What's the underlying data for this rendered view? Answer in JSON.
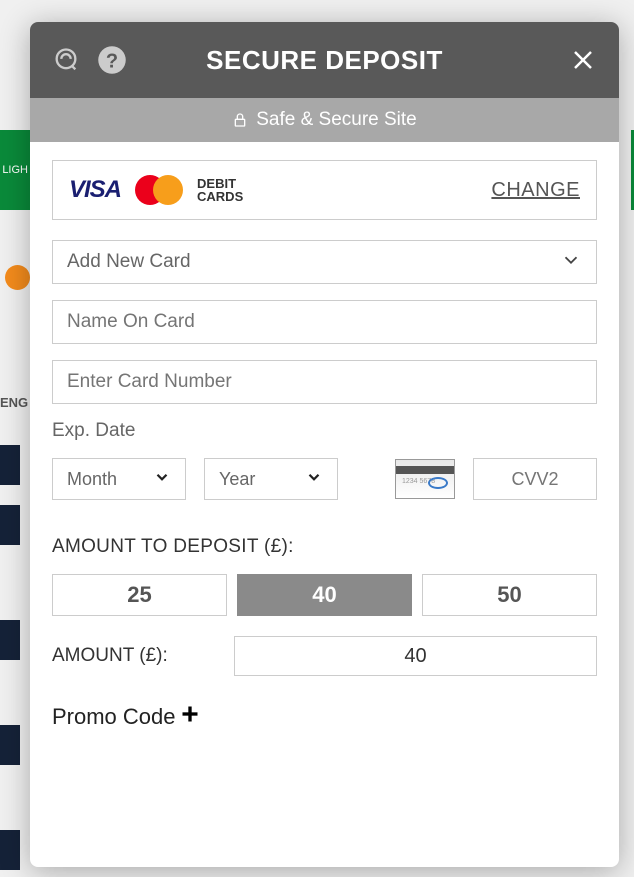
{
  "header": {
    "title": "SECURE DEPOSIT",
    "safe_text": "Safe & Secure Site"
  },
  "card_type": {
    "visa": "VISA",
    "debit_line1": "DEBIT",
    "debit_line2": "CARDS",
    "change": "CHANGE"
  },
  "card_form": {
    "add_new": "Add New Card",
    "name_placeholder": "Name On Card",
    "number_placeholder": "Enter Card Number",
    "exp_label": "Exp. Date",
    "month": "Month",
    "year": "Year",
    "cvv_placeholder": "CVV2"
  },
  "deposit": {
    "section_label": "AMOUNT TO DEPOSIT (£):",
    "btn1": "25",
    "btn2": "40",
    "btn3": "50",
    "amount_label": "AMOUNT (£):",
    "amount_value": "40"
  },
  "promo": {
    "label": "Promo Code"
  },
  "bg": {
    "highlight": "LIGH",
    "eng": "ENG"
  }
}
